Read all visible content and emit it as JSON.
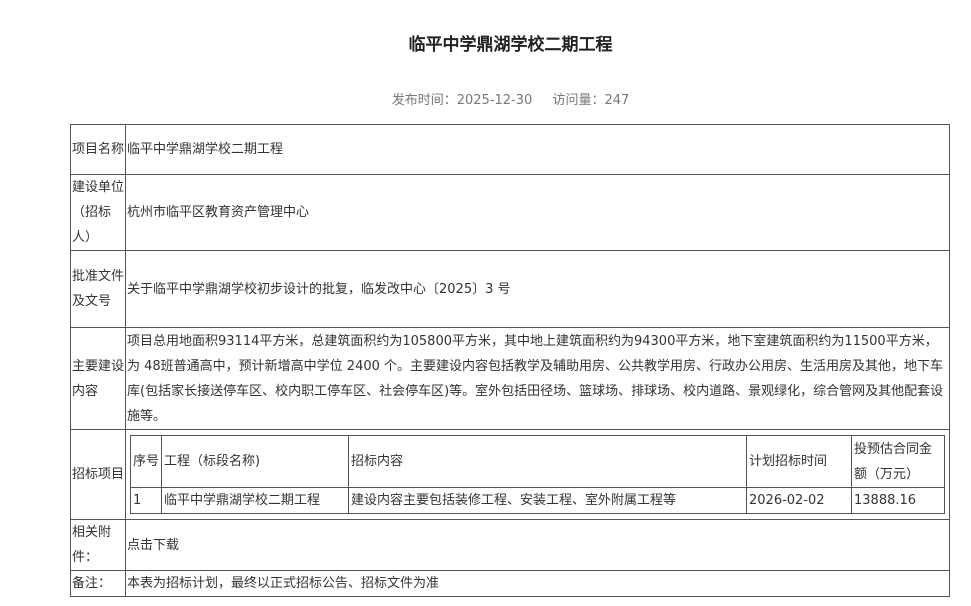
{
  "page": {
    "title": "临平中学鼎湖学校二期工程",
    "publish_label": "发布时间：2025-12-30",
    "views_label": "访问量：247"
  },
  "rows": {
    "project_name": {
      "label": "项目名称",
      "value": "临平中学鼎湖学校二期工程"
    },
    "builder": {
      "label": "建设单位（招标人）",
      "value": "杭州市临平区教育资产管理中心"
    },
    "approval": {
      "label": "批准文件及文号",
      "value": "关于临平中学鼎湖学校初步设计的批复，临发改中心〔2025〕3 号"
    },
    "content": {
      "label": "主要建设内容",
      "value": "项目总用地面积93114平方米，总建筑面积约为105800平方米，其中地上建筑面积约为94300平方米，地下室建筑面积约为11500平方米，为 48班普通高中，预计新增高中学位 2400 个。主要建设内容包括教学及辅助用房、公共教学用房、行政办公用房、生活用房及其他，地下车库(包括家长接送停车区、校内职工停车区、社会停车区)等。室外包括田径场、篮球场、排球场、校内道路、景观绿化，综合管网及其他配套设施等。"
    },
    "bidding": {
      "label": "招标项目",
      "headers": [
        "序号",
        "工程（标段名称)",
        "招标内容",
        "计划招标时间",
        "投预估合同金额（万元）"
      ],
      "rows": [
        [
          "1",
          "临平中学鼎湖学校二期工程",
          "建设内容主要包括装修工程、安装工程、室外附属工程等",
          "2026-02-02",
          "13888.16"
        ]
      ]
    },
    "attachment": {
      "label": "相关附件：",
      "value": "点击下载"
    },
    "remark": {
      "label": "备注：",
      "value": "本表为招标计划，最终以正式招标公告、招标文件为准"
    }
  }
}
